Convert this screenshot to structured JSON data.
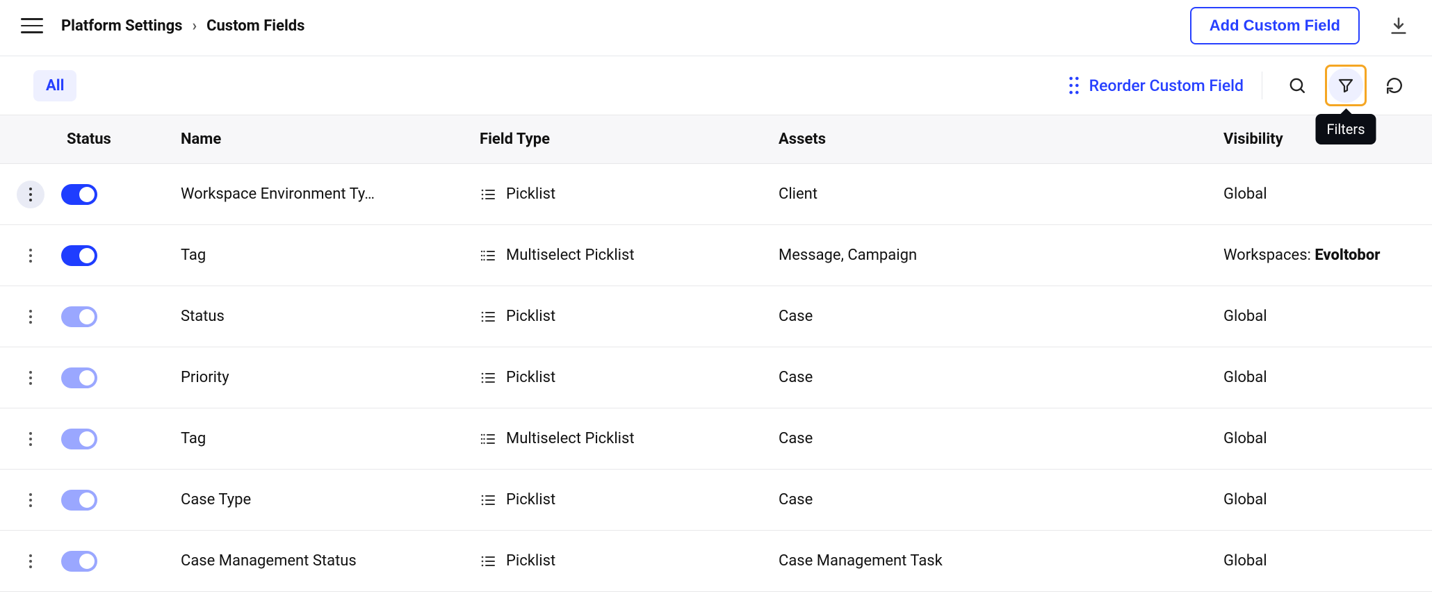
{
  "breadcrumb": {
    "platform_settings": "Platform Settings",
    "custom_fields": "Custom Fields"
  },
  "buttons": {
    "add_custom_field": "Add Custom Field"
  },
  "toolbar": {
    "chip_all": "All",
    "reorder": "Reorder Custom Field",
    "tooltip_filters": "Filters"
  },
  "columns": {
    "status": "Status",
    "name": "Name",
    "field_type": "Field Type",
    "assets": "Assets",
    "visibility": "Visibility"
  },
  "visibility_labels": {
    "workspaces_prefix": "Workspaces: ",
    "workspace_name": "Evoltobor"
  },
  "rows": [
    {
      "name": "Workspace Environment Ty…",
      "field_type": "Picklist",
      "assets": "Client",
      "visibility": "Global",
      "toggle_strong": true
    },
    {
      "name": "Tag",
      "field_type": "Multiselect Picklist",
      "assets": "Message, Campaign",
      "visibility": "WORKSPACES",
      "toggle_strong": true
    },
    {
      "name": "Status",
      "field_type": "Picklist",
      "assets": "Case",
      "visibility": "Global",
      "toggle_strong": false
    },
    {
      "name": "Priority",
      "field_type": "Picklist",
      "assets": "Case",
      "visibility": "Global",
      "toggle_strong": false
    },
    {
      "name": "Tag",
      "field_type": "Multiselect Picklist",
      "assets": "Case",
      "visibility": "Global",
      "toggle_strong": false
    },
    {
      "name": "Case Type",
      "field_type": "Picklist",
      "assets": "Case",
      "visibility": "Global",
      "toggle_strong": false
    },
    {
      "name": "Case Management Status",
      "field_type": "Picklist",
      "assets": "Case Management Task",
      "visibility": "Global",
      "toggle_strong": false
    }
  ]
}
